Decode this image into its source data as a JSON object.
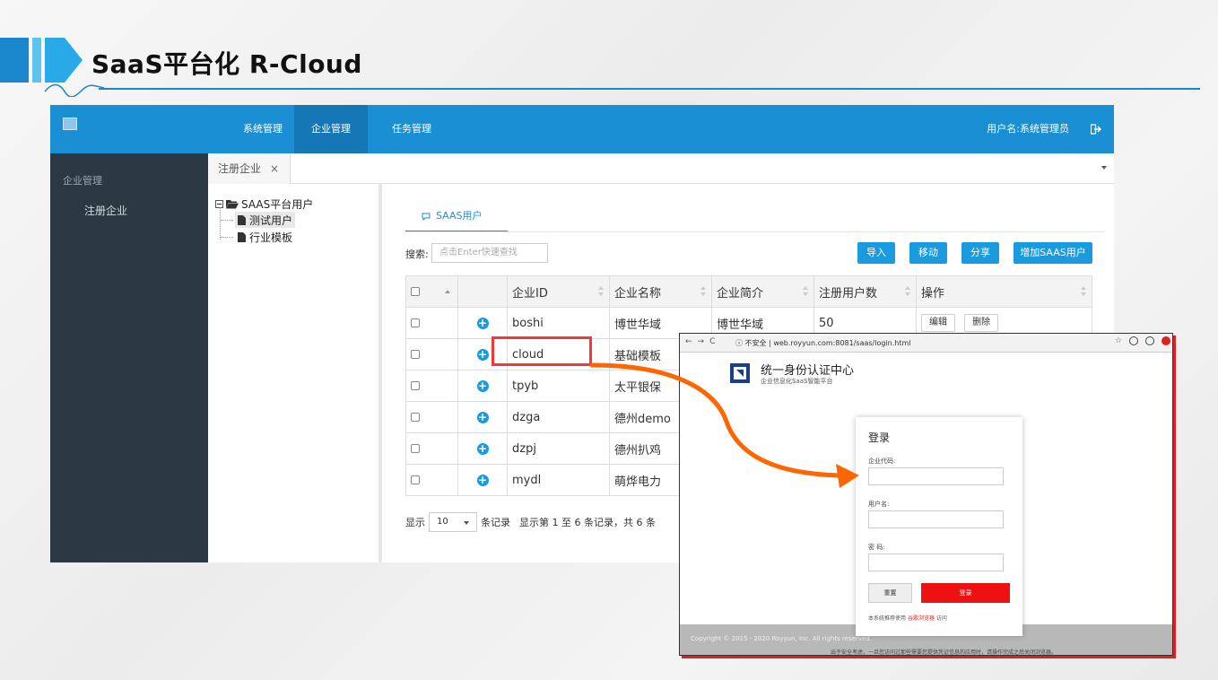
{
  "slide": {
    "title": "SaaS平台化 R-Cloud"
  },
  "app": {
    "nav": [
      "系统管理",
      "企业管理",
      "任务管理"
    ],
    "user_label": "用户名:系统管理员",
    "sidebar": {
      "heading": "企业管理",
      "item": "注册企业"
    },
    "tab": {
      "label": "注册企业",
      "close": "×"
    },
    "tree": {
      "root": "SAAS平台用户",
      "children": [
        "测试用户",
        "行业模板"
      ]
    },
    "content_tab": "SAAS用户",
    "search": {
      "label": "搜索:",
      "placeholder": "点击Enter快速查找"
    },
    "buttons": [
      "导入",
      "移动",
      "分享",
      "增加SAAS用户"
    ],
    "table": {
      "headers": [
        "企业ID",
        "企业名称",
        "企业简介",
        "注册用户数",
        "操作"
      ],
      "rows": [
        {
          "id": "boshi",
          "name": "博世华域",
          "intro": "博世华域",
          "users": "50"
        },
        {
          "id": "cloud",
          "name": "基础模板",
          "intro": "",
          "users": ""
        },
        {
          "id": "tpyb",
          "name": "太平银保",
          "intro": "",
          "users": ""
        },
        {
          "id": "dzga",
          "name": "德州demo",
          "intro": "",
          "users": ""
        },
        {
          "id": "dzpj",
          "name": "德州扒鸡",
          "intro": "",
          "users": ""
        },
        {
          "id": "mydl",
          "name": "萌烨电力",
          "intro": "",
          "users": ""
        }
      ],
      "row_actions": [
        "编辑",
        "删除"
      ]
    },
    "pager": {
      "show": "显示",
      "size": "10",
      "per": "条记录",
      "summary": "显示第 1 至 6 条记录，共 6 条"
    }
  },
  "login_window": {
    "url": {
      "secure_label": "不安全",
      "address": "web.royyun.com:8081/saas/login.html"
    },
    "brand_title": "统一身份认证中心",
    "brand_sub": "企业信息化SaaS智能平台",
    "card": {
      "title": "登录",
      "company_label": "企业代码:",
      "user_label": "用户名:",
      "password_label": "密   码:",
      "reset": "重置",
      "submit": "登录",
      "tip_prefix": "本系统推荐使用",
      "tip_browser": "谷歌浏览器",
      "tip_suffix": "访问"
    },
    "copyright": "Copyright © 2015 - 2020 Royyun, Inc. All rights reserved.",
    "notice": "出于安全考虑，一旦您访问过那些需要您提供凭证信息的应用时，请操作完成之后关闭浏览器。"
  },
  "colors": {
    "brand_blue": "#1a8fd4",
    "sidebar_dark": "#2b3a42",
    "highlight_red": "#f03a3a",
    "arrow_orange": "#ff6600"
  }
}
